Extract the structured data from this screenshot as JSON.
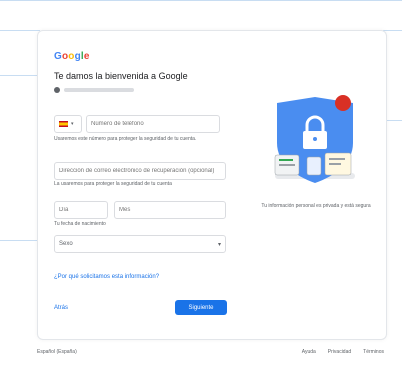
{
  "logo": [
    "G",
    "o",
    "o",
    "g",
    "l",
    "e"
  ],
  "title": "Te damos la bienvenida a Google",
  "phone": {
    "placeholder": "Número de teléfono",
    "hint": "Usaremos este número para proteger la seguridad de tu cuenta."
  },
  "recovery": {
    "placeholder": "Dirección de correo electrónico de recuperación (opcional)",
    "hint": "La usaremos para proteger la seguridad de tu cuenta"
  },
  "dob": {
    "day_placeholder": "Día",
    "month_placeholder": "Mes",
    "year_placeholder": "Año",
    "hint": "Tu fecha de nacimiento"
  },
  "gender": {
    "value": "Sexo"
  },
  "why_link": "¿Por qué solicitamos esta información?",
  "back_label": "Atrás",
  "next_label": "Siguiente",
  "caption": "Tu información personal es privada y está segura",
  "footer": {
    "language": "Español (España)",
    "links": [
      "Ayuda",
      "Privacidad",
      "Términos"
    ]
  },
  "colors": {
    "accent": "#1a73e8",
    "shield": "#4a8df0",
    "badge": "#d93025"
  }
}
